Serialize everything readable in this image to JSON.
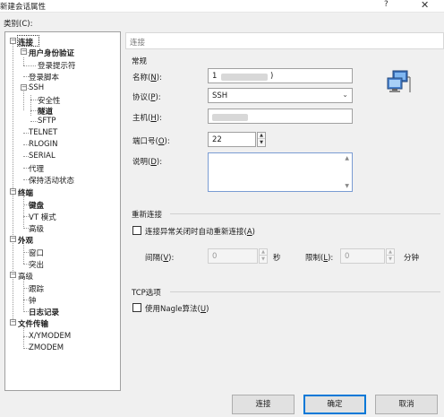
{
  "window": {
    "title": "新建会话属性",
    "help_glyph": "?",
    "close_glyph": "✕"
  },
  "category_label": "类别(C):",
  "tree": {
    "connection": "连接",
    "user_auth": "用户身份验证",
    "login_prompt": "登录提示符",
    "login_script": "登录脚本",
    "ssh": "SSH",
    "security": "安全性",
    "tunnel": "隧道",
    "sftp": "SFTP",
    "telnet": "TELNET",
    "rlogin": "RLOGIN",
    "serial": "SERIAL",
    "proxy": "代理",
    "keepalive": "保持活动状态",
    "terminal": "终端",
    "keyboard": "键盘",
    "vt_mode": "VT 模式",
    "advanced": "高级",
    "appearance": "外观",
    "window": "窗口",
    "highlight": "突出",
    "advanced2": "高级",
    "trace": "跟踪",
    "bell": "钟",
    "logging": "日志记录",
    "file_transfer": "文件传输",
    "xymodem": "X/YMODEM",
    "zmodem": "ZMODEM"
  },
  "panel": {
    "header": "连接",
    "general": {
      "title": "常规",
      "name_label": "名称(",
      "name_key": "N",
      "protocol_label": "协议(",
      "protocol_key": "P",
      "protocol_value": "SSH",
      "host_label": "主机(",
      "host_key": "H",
      "port_label": "端口号(",
      "port_key": "O",
      "port_value": "22",
      "desc_label": "说明(",
      "desc_key": "D",
      "label_close": "):",
      "name_value_start": "1",
      "name_value_end": ")"
    },
    "reconnect": {
      "title": "重新连接",
      "auto_label": "连接异常关闭时自动重新连接(",
      "auto_key": "A",
      "auto_close": ")",
      "auto_checked": false,
      "interval_label": "间隔(",
      "interval_key": "V",
      "interval_close": "):",
      "interval_value": "0",
      "interval_unit": "秒",
      "limit_label": "限制(",
      "limit_key": "L",
      "limit_close": "):",
      "limit_value": "0",
      "limit_unit": "分钟"
    },
    "tcp": {
      "title": "TCP选项",
      "nagle_label": "使用Nagle算法(",
      "nagle_key": "U",
      "nagle_close": ")",
      "nagle_checked": false
    }
  },
  "buttons": {
    "connect": "连接",
    "ok": "确定",
    "cancel": "取消"
  },
  "icons": {
    "monitor": "network-computer-icon",
    "dropdown": "chevron-down-icon"
  }
}
